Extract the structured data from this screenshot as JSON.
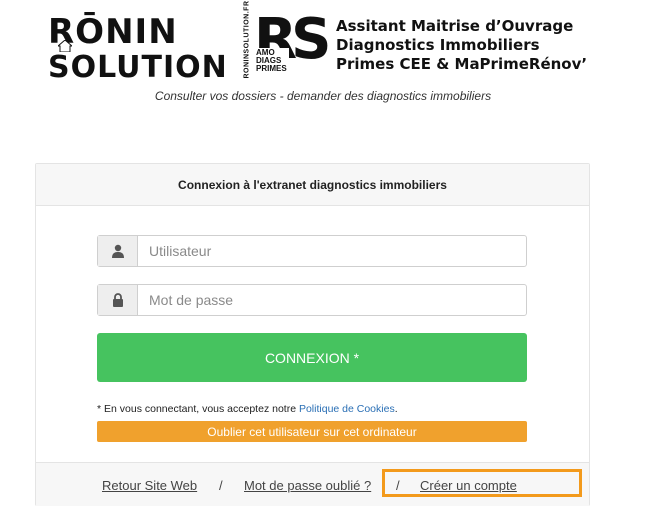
{
  "header": {
    "brand_line1": "RŌNIN",
    "brand_line2": "SOLUTION",
    "rs_vertical": "RONINSOLUTION.FR",
    "rs_letters": "RS",
    "rs_words": [
      "AMO",
      "DIAGS",
      "PRIMES"
    ],
    "tagline": [
      "Assitant Maitrise d’Ouvrage",
      "Diagnostics Immobiliers",
      "Primes CEE & MaPrimeRénov’"
    ],
    "subtitle": "Consulter vos dossiers - demander des diagnostics immobiliers"
  },
  "login": {
    "title": "Connexion  à l'extranet diagnostics immobiliers",
    "username_placeholder": "Utilisateur",
    "password_placeholder": "Mot de passe",
    "username_value": "",
    "password_value": "",
    "submit_label": "CONNEXION *",
    "consent_text": "* En vous connectant, vous acceptez notre ",
    "consent_link": "Politique de Cookies",
    "consent_end": ".",
    "forget_label": "Oublier cet utilisateur sur cet ordinateur"
  },
  "footer": {
    "back_link": "Retour Site Web",
    "sep": "/",
    "forgot_link": "Mot de passe oublié ?",
    "create_link": "Créer un compte"
  },
  "colors": {
    "login_button": "#46c35f",
    "forget_button": "#f0a12d",
    "highlight": "#f39a1c",
    "link": "#2a6fb5"
  },
  "icons": {
    "username_addon": "user-icon",
    "password_addon": "lock-icon"
  }
}
